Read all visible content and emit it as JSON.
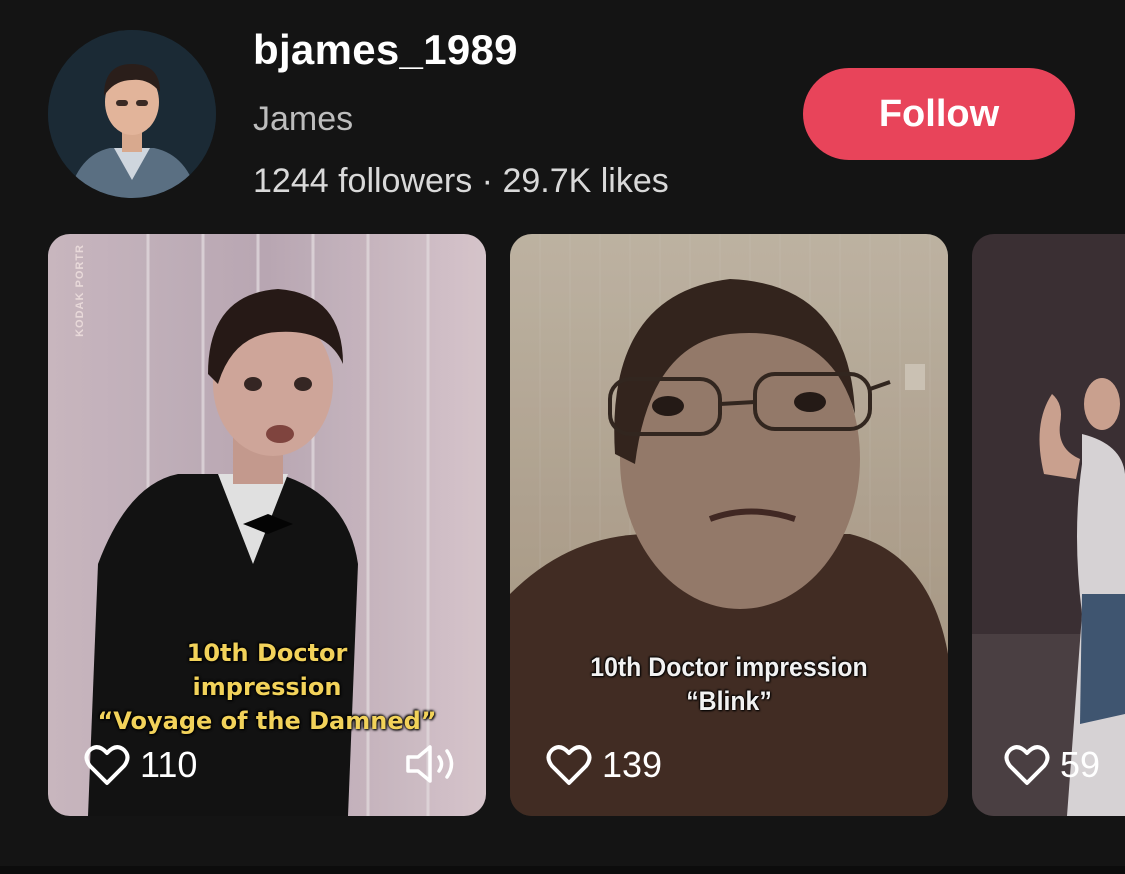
{
  "profile": {
    "username": "bjames_1989",
    "display_name": "James",
    "stats": "1244 followers · 29.7K likes",
    "follow_label": "Follow",
    "accent_color": "#e8445a"
  },
  "videos": [
    {
      "caption_line1": "10th Doctor",
      "caption_line2": "impression",
      "caption_line3": "“Voyage of the Damned”",
      "likes": "110",
      "watermark": "KODAK PORTR",
      "icons": [
        "heart-icon",
        "volume-icon"
      ]
    },
    {
      "caption_line1": "10th Doctor impression",
      "caption_line2": "“Blink”",
      "likes": "139",
      "icons": [
        "heart-icon"
      ]
    },
    {
      "likes": "59",
      "icons": [
        "heart-icon"
      ]
    }
  ]
}
